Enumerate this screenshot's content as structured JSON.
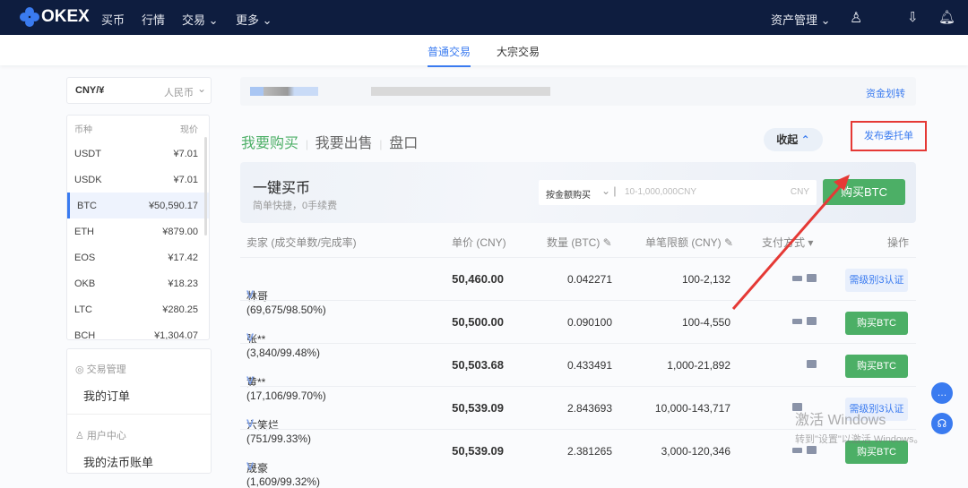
{
  "nav": {
    "brand": "OKEX",
    "items": [
      "买币",
      "行情",
      "交易",
      "更多"
    ],
    "asset": "资产管理"
  },
  "subtabs": [
    "普通交易",
    "大宗交易"
  ],
  "currency": {
    "value": "CNY/¥",
    "label": "人民币"
  },
  "coins": {
    "header": [
      "币种",
      "现价"
    ],
    "list": [
      [
        "USDT",
        "¥7.01"
      ],
      [
        "USDK",
        "¥7.01"
      ],
      [
        "BTC",
        "¥50,590.17"
      ],
      [
        "ETH",
        "¥879.00"
      ],
      [
        "EOS",
        "¥17.42"
      ],
      [
        "OKB",
        "¥18.23"
      ],
      [
        "LTC",
        "¥280.25"
      ],
      [
        "BCH",
        "¥1,304.07"
      ]
    ]
  },
  "side": {
    "trade_mgmt": "交易管理",
    "my_orders": "我的订单",
    "user_center": "用户中心",
    "bills": "我的法币账单"
  },
  "info": {
    "transfer": "资金划转"
  },
  "tabs": [
    "我要购买",
    "我要出售",
    "盘口"
  ],
  "collapse": "收起",
  "post_order": "发布委托单",
  "quick": {
    "title": "一键买币",
    "subtitle": "简单快捷，0手续费",
    "mode": "按金额购买",
    "placeholder": "10-1,000,000CNY",
    "unit": "CNY",
    "button": "购买BTC"
  },
  "table": {
    "headers": [
      "卖家 (成交单数/完成率)",
      "单价 (CNY)",
      "数量 (BTC)",
      "单笔限额 (CNY)",
      "支付方式",
      "操作"
    ],
    "rows": [
      {
        "seller": "林哥 (69,675/98.50%)",
        "price": "50,460.00",
        "qty": "0.042271",
        "limit": "100-2,132",
        "action": "需级别3认证"
      },
      {
        "seller": "张** (3,840/99.48%)",
        "price": "50,500.00",
        "qty": "0.090100",
        "limit": "100-4,550",
        "action": "购买BTC"
      },
      {
        "seller": "黄** (17,106/99.70%)",
        "price": "50,503.68",
        "qty": "0.433491",
        "limit": "1,000-21,892",
        "action": "购买BTC"
      },
      {
        "seller": "六笑烂 (751/99.33%)",
        "price": "50,539.09",
        "qty": "2.843693",
        "limit": "10,000-143,717",
        "action": "需级别3认证"
      },
      {
        "seller": "晟豪 (1,609/99.32%)",
        "price": "50,539.09",
        "qty": "2.381265",
        "limit": "3,000-120,346",
        "action": "购买BTC"
      }
    ]
  },
  "verified": "V",
  "watermark": {
    "title": "激活 Windows",
    "sub": "转到\"设置\"以激活 Windows。"
  }
}
